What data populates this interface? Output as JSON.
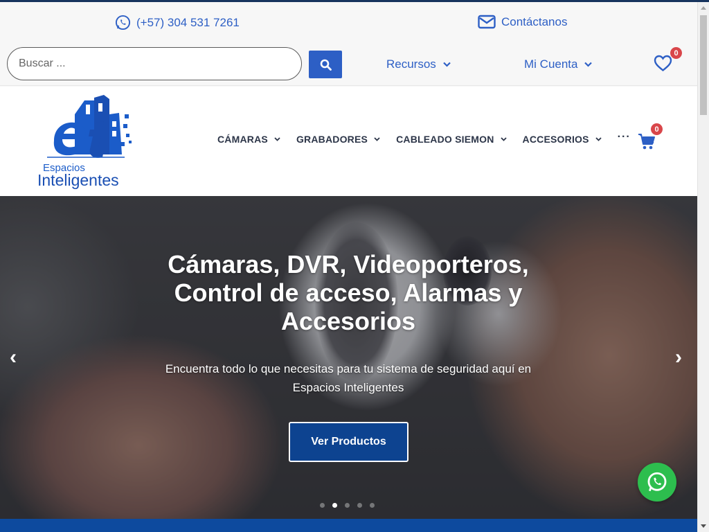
{
  "topbar": {
    "phone": "(+57) 304 531 7261",
    "contact": "Contáctanos",
    "search_placeholder": "Buscar ...",
    "resources": "Recursos",
    "account": "Mi Cuenta",
    "wishlist_count": "0"
  },
  "header": {
    "logo_text_line1": "Espacios",
    "logo_text_line2": "Inteligentes",
    "nav": [
      "CÁMARAS",
      "GRABADORES",
      "CABLEADO SIEMON",
      "ACCESORIOS"
    ],
    "more": "···",
    "cart_count": "0"
  },
  "hero": {
    "title": "Cámaras, DVR, Videoporteros, Control de acceso, Alarmas y Accesorios",
    "subtitle": "Encuentra todo lo que necesitas para tu sistema de seguridad aquí en Espacios Inteligentes",
    "button": "Ver Productos",
    "prev": "‹",
    "next": "›",
    "active_slide": 2,
    "slide_count": 5
  },
  "colors": {
    "accent": "#2d5fc5",
    "dark_blue": "#0d4390",
    "badge": "#d9464a",
    "whatsapp": "#2dbe4e"
  }
}
